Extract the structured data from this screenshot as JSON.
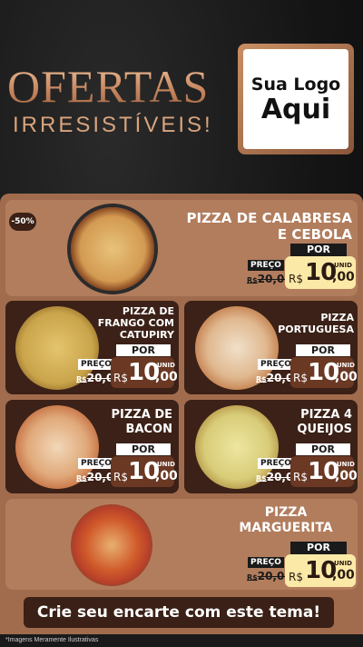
{
  "header": {
    "title": "OFERTAS",
    "subtitle": "IRRESISTÍVEIS!",
    "logo_line1": "Sua Logo",
    "logo_line2": "Aqui"
  },
  "discount_badge": "-50%",
  "price_common": {
    "preco_label": "PREÇO",
    "por_label": "POR",
    "currency": "R$",
    "unit": "UNID",
    "old_value": "20,00",
    "new_int": "10",
    "new_cents": ",00"
  },
  "products": [
    {
      "name_line1": "PIZZA DE CALABRESA",
      "name_line2": "E CEBOLA"
    },
    {
      "name_line1": "PIZZA DE",
      "name_line2": "FRANGO COM",
      "name_line3": "CATUPIRY"
    },
    {
      "name_line1": "PIZZA",
      "name_line2": "PORTUGUESA"
    },
    {
      "name_line1": "PIZZA DE",
      "name_line2": "BACON"
    },
    {
      "name_line1": "PIZZA 4",
      "name_line2": "QUEIJOS"
    },
    {
      "name_line1": "PIZZA",
      "name_line2": "MARGUERITA"
    }
  ],
  "cta": "Crie seu encarte com este tema!",
  "footnote": "*Imagens Meramente Ilustrativas",
  "colors": {
    "accent": "#a16c4d",
    "dark": "#3b2117",
    "price_cream": "#fbe9a8",
    "price_brown": "#6a3823"
  }
}
